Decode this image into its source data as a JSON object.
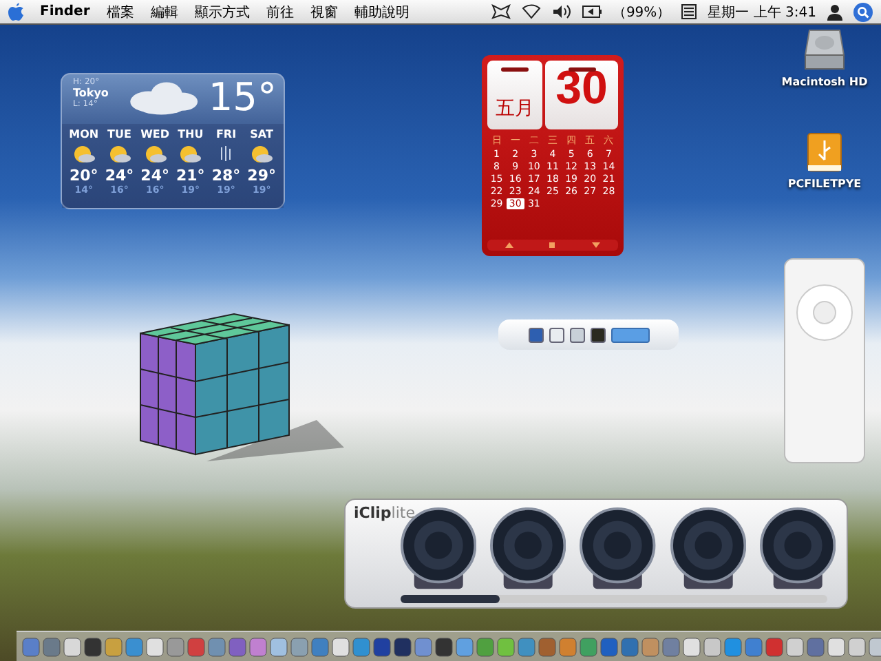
{
  "menu_bar": {
    "app": "Finder",
    "items": [
      "檔案",
      "編輯",
      "顯示方式",
      "前往",
      "視窗",
      "輔助說明"
    ],
    "battery": "（99%）",
    "clock": "星期一 上午 3:41"
  },
  "weather": {
    "high": "H: 20°",
    "city": "Tokyo",
    "low": "L: 14°",
    "temperature": "15°",
    "days": [
      {
        "day": "MON",
        "kind": "sun",
        "high": "20°",
        "low": "14°"
      },
      {
        "day": "TUE",
        "kind": "sun",
        "high": "24°",
        "low": "16°"
      },
      {
        "day": "WED",
        "kind": "sun",
        "high": "24°",
        "low": "16°"
      },
      {
        "day": "THU",
        "kind": "sun",
        "high": "21°",
        "low": "19°"
      },
      {
        "day": "FRI",
        "kind": "rain",
        "high": "28°",
        "low": "19°"
      },
      {
        "day": "SAT",
        "kind": "sun",
        "high": "29°",
        "low": "19°"
      }
    ]
  },
  "calendar": {
    "month": "五月",
    "date": "30",
    "weekdays": [
      "日",
      "一",
      "二",
      "三",
      "四",
      "五",
      "六"
    ],
    "days": [
      {
        "label": "1",
        "selected": false
      },
      {
        "label": "2",
        "selected": false
      },
      {
        "label": "3",
        "selected": false
      },
      {
        "label": "4",
        "selected": false
      },
      {
        "label": "5",
        "selected": false
      },
      {
        "label": "6",
        "selected": false
      },
      {
        "label": "7",
        "selected": false
      },
      {
        "label": "8",
        "selected": false
      },
      {
        "label": "9",
        "selected": false
      },
      {
        "label": "10",
        "selected": false
      },
      {
        "label": "11",
        "selected": false
      },
      {
        "label": "12",
        "selected": false
      },
      {
        "label": "13",
        "selected": false
      },
      {
        "label": "14",
        "selected": false
      },
      {
        "label": "15",
        "selected": false
      },
      {
        "label": "16",
        "selected": false
      },
      {
        "label": "17",
        "selected": false
      },
      {
        "label": "18",
        "selected": false
      },
      {
        "label": "19",
        "selected": false
      },
      {
        "label": "20",
        "selected": false
      },
      {
        "label": "21",
        "selected": false
      },
      {
        "label": "22",
        "selected": false
      },
      {
        "label": "23",
        "selected": false
      },
      {
        "label": "24",
        "selected": false
      },
      {
        "label": "25",
        "selected": false
      },
      {
        "label": "26",
        "selected": false
      },
      {
        "label": "27",
        "selected": false
      },
      {
        "label": "28",
        "selected": false
      },
      {
        "label": "29",
        "selected": false
      },
      {
        "label": "30",
        "selected": true
      },
      {
        "label": "31",
        "selected": false
      }
    ]
  },
  "desktop_icons": [
    {
      "label": "Macintosh HD",
      "kind": "disk"
    },
    {
      "label": "PCFILETPYE",
      "kind": "usb"
    }
  ],
  "view_switcher": {
    "options": [
      {
        "kind": "blue",
        "selected": false
      },
      {
        "kind": "window",
        "selected": false
      },
      {
        "kind": "split",
        "selected": false
      },
      {
        "kind": "dark",
        "selected": false
      },
      {
        "kind": "tab",
        "selected": true
      }
    ]
  },
  "iclip": {
    "title": "iClip",
    "title_suffix": "lite",
    "slots": [
      {
        "kind": "reel"
      },
      {
        "kind": "reel"
      },
      {
        "kind": "reel"
      },
      {
        "kind": "reel"
      },
      {
        "kind": "reel"
      }
    ]
  }
}
